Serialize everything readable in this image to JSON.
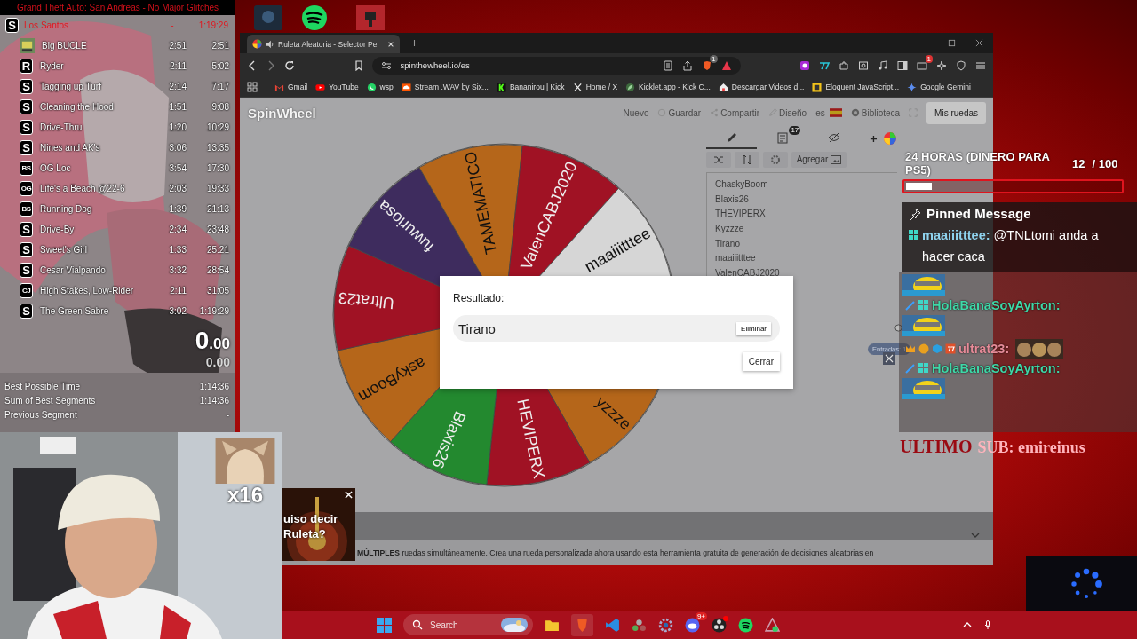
{
  "splits": {
    "title": "Grand Theft Auto: San Andreas - No Major Glitches",
    "header": {
      "icon": "S",
      "name": "Los Santos",
      "delta": "-",
      "time": "1:19:29"
    },
    "rows": [
      {
        "kind": "picture",
        "name": "Big BUCLE",
        "segment": "2:51",
        "total": "2:51"
      },
      {
        "kind": "letter",
        "icon": "R",
        "name": "Ryder",
        "segment": "2:11",
        "total": "5:02"
      },
      {
        "kind": "letter",
        "icon": "S",
        "name": "Tagging up Turf",
        "segment": "2:14",
        "total": "7:17"
      },
      {
        "kind": "letter",
        "icon": "S",
        "name": "Cleaning the Hood",
        "segment": "1:51",
        "total": "9:08"
      },
      {
        "kind": "letter",
        "icon": "S",
        "name": "Drive-Thru",
        "segment": "1:20",
        "total": "10:29"
      },
      {
        "kind": "letter",
        "icon": "S",
        "name": "Nines and AK's",
        "segment": "3:06",
        "total": "13:35"
      },
      {
        "kind": "letter",
        "icon": "BS",
        "name": "OG Loc",
        "segment": "3:54",
        "total": "17:30"
      },
      {
        "kind": "letter",
        "icon": "OG",
        "name": "Life's a Beach @22-6",
        "segment": "2:03",
        "total": "19:33"
      },
      {
        "kind": "letter",
        "icon": "BS",
        "name": "Running Dog",
        "segment": "1:39",
        "total": "21:13"
      },
      {
        "kind": "letter",
        "icon": "S",
        "name": "Drive-By",
        "segment": "2:34",
        "total": "23:48"
      },
      {
        "kind": "letter",
        "icon": "S",
        "name": "Sweet's Girl",
        "segment": "1:33",
        "total": "25:21"
      },
      {
        "kind": "letter",
        "icon": "S",
        "name": "Cesar Vialpando",
        "segment": "3:32",
        "total": "28:54"
      },
      {
        "kind": "letter",
        "icon": "CJ",
        "name": "High Stakes, Low-Rider",
        "segment": "2:11",
        "total": "31:05"
      },
      {
        "kind": "letter",
        "icon": "S",
        "name": "The Green Sabre",
        "segment": "3:02",
        "total": "1:19:29"
      }
    ],
    "timer_whole": "0",
    "timer_fraction": ".00",
    "segment_timer": "0.00",
    "stats": [
      {
        "label": "Best Possible Time",
        "value": "1:14:36"
      },
      {
        "label": "Sum of Best Segments",
        "value": "1:14:36"
      },
      {
        "label": "Previous Segment",
        "value": "-"
      }
    ]
  },
  "browser": {
    "tab": {
      "title": "Ruleta Aleatoria - Selector Pe",
      "audio": true
    },
    "url": "spinthewheel.io/es",
    "shield_badge": "1",
    "extension_badge": "1",
    "bookmarks": [
      {
        "kind": "mail",
        "label": "Gmail"
      },
      {
        "kind": "video",
        "label": "YouTube"
      },
      {
        "kind": "phone",
        "label": "wsp"
      },
      {
        "kind": "cloud",
        "label": "Stream .WAV by Six..."
      },
      {
        "kind": "kick",
        "label": "Bananirou | Kick"
      },
      {
        "kind": "x",
        "label": "Home / X"
      },
      {
        "kind": "leaf",
        "label": "Kicklet.app - Kick C..."
      },
      {
        "kind": "house",
        "label": "Descargar Videos d..."
      },
      {
        "kind": "js",
        "label": "Eloquent JavaScript..."
      },
      {
        "kind": "star",
        "label": "Google Gemini"
      }
    ]
  },
  "page": {
    "logo": "SpinWheel",
    "nav": [
      {
        "kind": "plain",
        "label": "Nuevo"
      },
      {
        "kind": "save",
        "label": "Guardar"
      },
      {
        "kind": "share",
        "label": "Compartir"
      },
      {
        "kind": "pencil",
        "label": "Diseño"
      },
      {
        "kind": "flag",
        "label": "es"
      },
      {
        "kind": "globe",
        "label": "Biblioteca"
      }
    ],
    "my_wheels": "Mis ruedas",
    "wheel": [
      {
        "label": "yzzze",
        "color": "#b5661a"
      },
      {
        "label": "HEVIPERX",
        "color": "#a01224"
      },
      {
        "label": "Blaxis26",
        "color": "#23892f"
      },
      {
        "label": "askyBoom",
        "color": "#b5661a"
      },
      {
        "label": "Ultrat23",
        "color": "#a01224"
      },
      {
        "label": "fuwuriosa",
        "color": "#3e2c5e"
      },
      {
        "label": "TAMEMATICO",
        "color": "#b5661a"
      },
      {
        "label": "ValenCABJ2020",
        "color": "#a01224"
      },
      {
        "label": "maaiiitttee",
        "color": "#d6d6d6"
      }
    ],
    "editor": {
      "tabs": [
        {
          "kind": "edit",
          "selected": true
        },
        {
          "kind": "results",
          "selected": false,
          "badge": "17"
        },
        {
          "kind": "hidden",
          "selected": false
        }
      ],
      "add_label": "Agregar",
      "entries": [
        "ChaskyBoom",
        "Blaxis26",
        "THEVIPERX",
        "Kyzzze",
        "Tirano",
        "maaiiitttee",
        "ValenCABJ2020"
      ],
      "count": "Entradas: 1"
    },
    "result": {
      "label": "Resultado:",
      "value": "Tirano",
      "remove": "Eliminar",
      "close": "Cerrar"
    },
    "footer": "**MÚLTIPLES** ruedas simultáneamente. Crea una rueda personalizada ahora usando esta herramienta gratuita de generación de decisiones aleatorias en"
  },
  "goal": {
    "title": "24 HORAS (DINERO PARA PS5)",
    "count": "12",
    "total": "/ 100",
    "level": 0.12
  },
  "chat": {
    "pinned": {
      "heading": "Pinned Message",
      "user": "maaiiitttee:",
      "text": "@TNLtomi anda a hacer caca",
      "color": "#8fd3ee"
    },
    "messages": [
      {
        "user": "HolaBanaSoyAyrton:",
        "color": "#3fd8a8",
        "kind": "mod"
      },
      {
        "user": "ultrat23:",
        "color": "#e58b98",
        "kind": "sub"
      },
      {
        "user": "HolaBanaSoyAyrton:",
        "color": "#3fd8a8",
        "kind": "mod"
      }
    ]
  },
  "last_sub": {
    "label": "ULTIMO",
    "name": "SUB: emireinus"
  },
  "cam_overlay": "x16",
  "ad": {
    "text": "uiso decir Ruleta?"
  },
  "taskbar": {
    "search": {
      "placeholder": "Search"
    },
    "badge": "9+"
  }
}
